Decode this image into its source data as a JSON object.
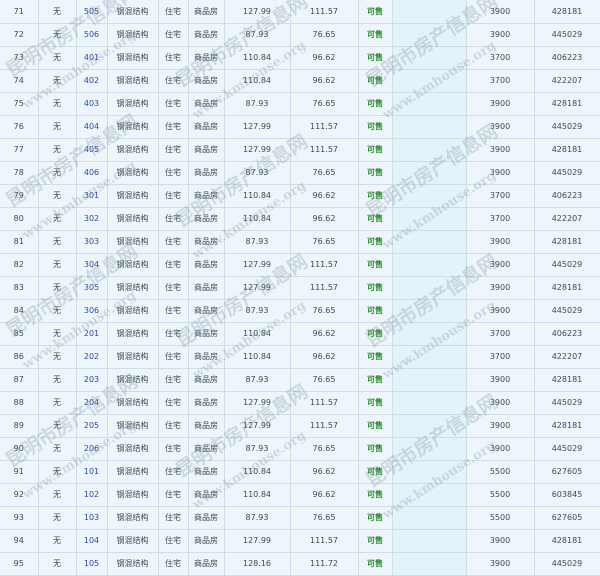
{
  "rows": [
    {
      "idx": "71",
      "unit": "无",
      "room": "505",
      "structure": "钢混结构",
      "use": "住宅",
      "type": "商品房",
      "area": "127.99",
      "inner": "111.57",
      "status": "可售",
      "price": "3900",
      "total": "428181"
    },
    {
      "idx": "72",
      "unit": "无",
      "room": "506",
      "structure": "钢混结构",
      "use": "住宅",
      "type": "商品房",
      "area": "87.93",
      "inner": "76.65",
      "status": "可售",
      "price": "3900",
      "total": "445029"
    },
    {
      "idx": "73",
      "unit": "无",
      "room": "401",
      "structure": "钢混结构",
      "use": "住宅",
      "type": "商品房",
      "area": "110.84",
      "inner": "96.62",
      "status": "可售",
      "price": "3700",
      "total": "406223"
    },
    {
      "idx": "74",
      "unit": "无",
      "room": "402",
      "structure": "钢混结构",
      "use": "住宅",
      "type": "商品房",
      "area": "110.84",
      "inner": "96.62",
      "status": "可售",
      "price": "3700",
      "total": "422207"
    },
    {
      "idx": "75",
      "unit": "无",
      "room": "403",
      "structure": "钢混结构",
      "use": "住宅",
      "type": "商品房",
      "area": "87.93",
      "inner": "76.65",
      "status": "可售",
      "price": "3900",
      "total": "428181"
    },
    {
      "idx": "76",
      "unit": "无",
      "room": "404",
      "structure": "钢混结构",
      "use": "住宅",
      "type": "商品房",
      "area": "127.99",
      "inner": "111.57",
      "status": "可售",
      "price": "3900",
      "total": "445029"
    },
    {
      "idx": "77",
      "unit": "无",
      "room": "405",
      "structure": "钢混结构",
      "use": "住宅",
      "type": "商品房",
      "area": "127.99",
      "inner": "111.57",
      "status": "可售",
      "price": "3900",
      "total": "428181"
    },
    {
      "idx": "78",
      "unit": "无",
      "room": "406",
      "structure": "钢混结构",
      "use": "住宅",
      "type": "商品房",
      "area": "87.93",
      "inner": "76.65",
      "status": "可售",
      "price": "3900",
      "total": "445029"
    },
    {
      "idx": "79",
      "unit": "无",
      "room": "301",
      "structure": "钢混结构",
      "use": "住宅",
      "type": "商品房",
      "area": "110.84",
      "inner": "96.62",
      "status": "可售",
      "price": "3700",
      "total": "406223"
    },
    {
      "idx": "80",
      "unit": "无",
      "room": "302",
      "structure": "钢混结构",
      "use": "住宅",
      "type": "商品房",
      "area": "110.84",
      "inner": "96.62",
      "status": "可售",
      "price": "3700",
      "total": "422207"
    },
    {
      "idx": "81",
      "unit": "无",
      "room": "303",
      "structure": "钢混结构",
      "use": "住宅",
      "type": "商品房",
      "area": "87.93",
      "inner": "76.65",
      "status": "可售",
      "price": "3900",
      "total": "428181"
    },
    {
      "idx": "82",
      "unit": "无",
      "room": "304",
      "structure": "钢混结构",
      "use": "住宅",
      "type": "商品房",
      "area": "127.99",
      "inner": "111.57",
      "status": "可售",
      "price": "3900",
      "total": "445029"
    },
    {
      "idx": "83",
      "unit": "无",
      "room": "305",
      "structure": "钢混结构",
      "use": "住宅",
      "type": "商品房",
      "area": "127.99",
      "inner": "111.57",
      "status": "可售",
      "price": "3900",
      "total": "428181"
    },
    {
      "idx": "84",
      "unit": "无",
      "room": "306",
      "structure": "钢混结构",
      "use": "住宅",
      "type": "商品房",
      "area": "87.93",
      "inner": "76.65",
      "status": "可售",
      "price": "3900",
      "total": "445029"
    },
    {
      "idx": "85",
      "unit": "无",
      "room": "201",
      "structure": "钢混结构",
      "use": "住宅",
      "type": "商品房",
      "area": "110.84",
      "inner": "96.62",
      "status": "可售",
      "price": "3700",
      "total": "406223"
    },
    {
      "idx": "86",
      "unit": "无",
      "room": "202",
      "structure": "钢混结构",
      "use": "住宅",
      "type": "商品房",
      "area": "110.84",
      "inner": "96.62",
      "status": "可售",
      "price": "3700",
      "total": "422207"
    },
    {
      "idx": "87",
      "unit": "无",
      "room": "203",
      "structure": "钢混结构",
      "use": "住宅",
      "type": "商品房",
      "area": "87.93",
      "inner": "76.65",
      "status": "可售",
      "price": "3900",
      "total": "428181"
    },
    {
      "idx": "88",
      "unit": "无",
      "room": "204",
      "structure": "钢混结构",
      "use": "住宅",
      "type": "商品房",
      "area": "127.99",
      "inner": "111.57",
      "status": "可售",
      "price": "3900",
      "total": "445029"
    },
    {
      "idx": "89",
      "unit": "无",
      "room": "205",
      "structure": "钢混结构",
      "use": "住宅",
      "type": "商品房",
      "area": "127.99",
      "inner": "111.57",
      "status": "可售",
      "price": "3900",
      "total": "428181"
    },
    {
      "idx": "90",
      "unit": "无",
      "room": "206",
      "structure": "钢混结构",
      "use": "住宅",
      "type": "商品房",
      "area": "87.93",
      "inner": "76.65",
      "status": "可售",
      "price": "3900",
      "total": "445029"
    },
    {
      "idx": "91",
      "unit": "无",
      "room": "101",
      "structure": "钢混结构",
      "use": "住宅",
      "type": "商品房",
      "area": "110.84",
      "inner": "96.62",
      "status": "可售",
      "price": "5500",
      "total": "627605"
    },
    {
      "idx": "92",
      "unit": "无",
      "room": "102",
      "structure": "钢混结构",
      "use": "住宅",
      "type": "商品房",
      "area": "110.84",
      "inner": "96.62",
      "status": "可售",
      "price": "5500",
      "total": "603845"
    },
    {
      "idx": "93",
      "unit": "无",
      "room": "103",
      "structure": "钢混结构",
      "use": "住宅",
      "type": "商品房",
      "area": "87.93",
      "inner": "76.65",
      "status": "可售",
      "price": "5500",
      "total": "627605"
    },
    {
      "idx": "94",
      "unit": "无",
      "room": "104",
      "structure": "钢混结构",
      "use": "住宅",
      "type": "商品房",
      "area": "127.99",
      "inner": "111.57",
      "status": "可售",
      "price": "3900",
      "total": "428181"
    },
    {
      "idx": "95",
      "unit": "无",
      "room": "105",
      "structure": "钢混结构",
      "use": "住宅",
      "type": "商品房",
      "area": "128.16",
      "inner": "111.72",
      "status": "可售",
      "price": "3900",
      "total": "445029"
    }
  ],
  "watermark": {
    "cn": "昆明市房产信息网",
    "url": "www.kmhouse.org"
  }
}
